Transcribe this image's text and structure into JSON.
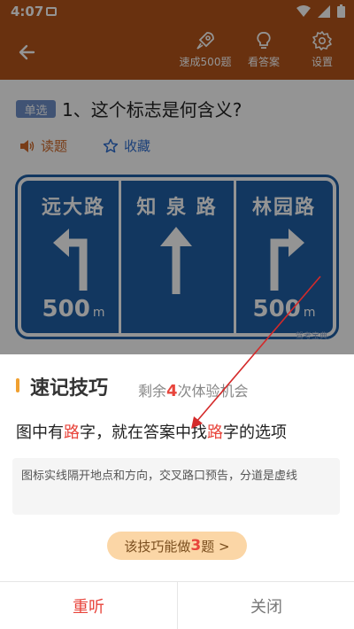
{
  "status_bar": {
    "time": "4:07"
  },
  "header": {
    "actions": [
      {
        "label": "速成500题",
        "icon": "rocket-icon"
      },
      {
        "label": "看答案",
        "icon": "lightbulb-icon"
      },
      {
        "label": "设置",
        "icon": "gear-icon"
      }
    ]
  },
  "question": {
    "type_badge": "单选",
    "title": "1、这个标志是何含义?",
    "read_label": "读题",
    "favorite_label": "收藏"
  },
  "sign": {
    "directions": [
      {
        "name": "远大路",
        "arrow": "turn-left",
        "distance": "500",
        "unit": "m"
      },
      {
        "name": "知 泉 路",
        "arrow": "straight",
        "distance": "",
        "unit": ""
      },
      {
        "name": "林园路",
        "arrow": "turn-right",
        "distance": "500",
        "unit": "m"
      }
    ],
    "watermark": "驾考宝典"
  },
  "sheet": {
    "title": "速记技巧",
    "remain_prefix": "剩余",
    "remain_count": "4",
    "remain_suffix": "次体验机会",
    "tip_parts": [
      "图中有",
      "路",
      "字，就在答案中找",
      "路",
      "字的选项"
    ],
    "description": "图标实线隔开地点和方向，交叉路口预告，分道是虚线",
    "pill_prefix": "该技巧能做",
    "pill_count": "3",
    "pill_suffix": "题 >",
    "replay_label": "重听",
    "close_label": "关闭"
  },
  "colors": {
    "header": "#b5551a",
    "accent_red": "#e8453c",
    "sign_blue": "#1f5fa6",
    "pill": "#fbd6a6"
  }
}
